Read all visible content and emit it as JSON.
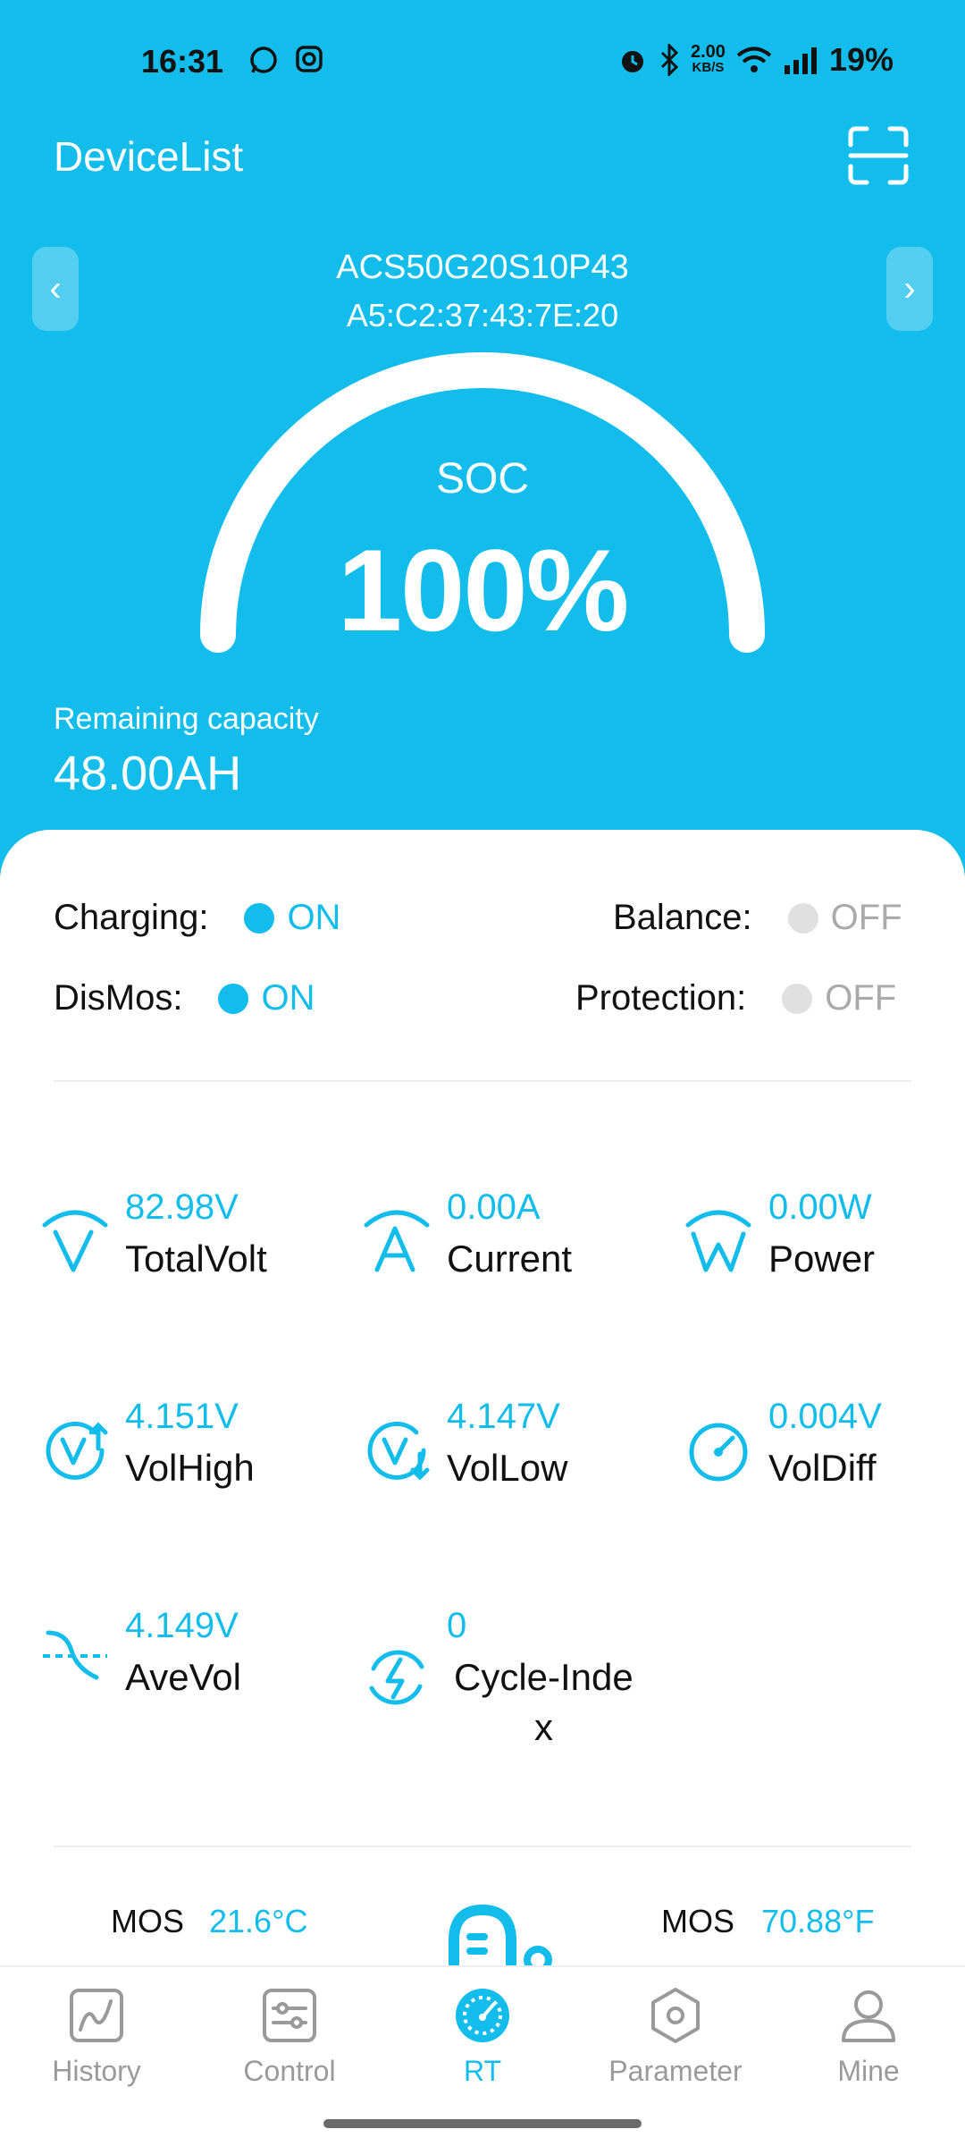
{
  "status_bar": {
    "time": "16:31",
    "net_speed_value": "2.00",
    "net_speed_unit": "KB/S",
    "battery": "19%"
  },
  "appbar": {
    "title": "DeviceList"
  },
  "device": {
    "name": "ACS50G20S10P43",
    "mac": "A5:C2:37:43:7E:20"
  },
  "soc": {
    "label": "SOC",
    "value": "100%",
    "fraction": 1.0
  },
  "remaining": {
    "label": "Remaining capacity",
    "value": "48.00AH"
  },
  "states": {
    "charging": {
      "label": "Charging:",
      "state": "ON"
    },
    "balance": {
      "label": "Balance:",
      "state": "OFF"
    },
    "dismos": {
      "label": "DisMos:",
      "state": "ON"
    },
    "protection": {
      "label": "Protection:",
      "state": "OFF"
    }
  },
  "metrics": [
    {
      "value": "82.98V",
      "label": "TotalVolt",
      "icon": "total-volt-icon"
    },
    {
      "value": "0.00A",
      "label": "Current",
      "icon": "current-icon"
    },
    {
      "value": "0.00W",
      "label": "Power",
      "icon": "power-icon"
    },
    {
      "value": "4.151V",
      "label": "VolHigh",
      "icon": "vol-high-icon"
    },
    {
      "value": "4.147V",
      "label": "VolLow",
      "icon": "vol-low-icon"
    },
    {
      "value": "0.004V",
      "label": "VolDiff",
      "icon": "vol-diff-icon"
    },
    {
      "value": "4.149V",
      "label": "AveVol",
      "icon": "ave-vol-icon"
    },
    {
      "value": "0",
      "label": "Cycle-Inde",
      "label2": "x",
      "icon": "cycle-index-icon"
    }
  ],
  "temps": {
    "left": {
      "label": "MOS",
      "value": "21.6°C"
    },
    "right": {
      "label": "MOS",
      "value": "70.88°F"
    }
  },
  "tabs": [
    {
      "label": "History",
      "icon": "history-icon"
    },
    {
      "label": "Control",
      "icon": "control-icon"
    },
    {
      "label": "RT",
      "icon": "rt-gauge-icon",
      "active": true
    },
    {
      "label": "Parameter",
      "icon": "parameter-icon"
    },
    {
      "label": "Mine",
      "icon": "mine-user-icon"
    }
  ],
  "colors": {
    "accent": "#12BCEB",
    "off": "#E0E0E0"
  }
}
